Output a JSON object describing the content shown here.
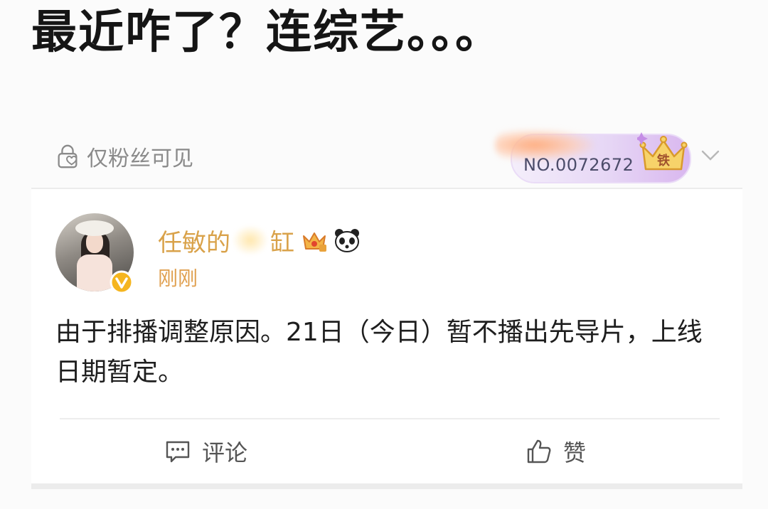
{
  "headline": "最近咋了？连综艺。。。",
  "visibility": {
    "label": "仅粉丝可见",
    "icon": "lock-heart-icon"
  },
  "fan_badge": {
    "number": "NO.0072672",
    "level_label": "铁",
    "icon": "crown-icon",
    "gradient_color": "#d9b7ef"
  },
  "post": {
    "author_prefix": "任敏的",
    "author_suffix": "缸",
    "timestamp": "刚刚",
    "text": "由于排播调整原因。21日（今日）暂不播出先导片，上线日期暂定。",
    "name_color": "#d9a24a"
  },
  "actions": {
    "comment_label": "评论",
    "like_label": "赞"
  }
}
